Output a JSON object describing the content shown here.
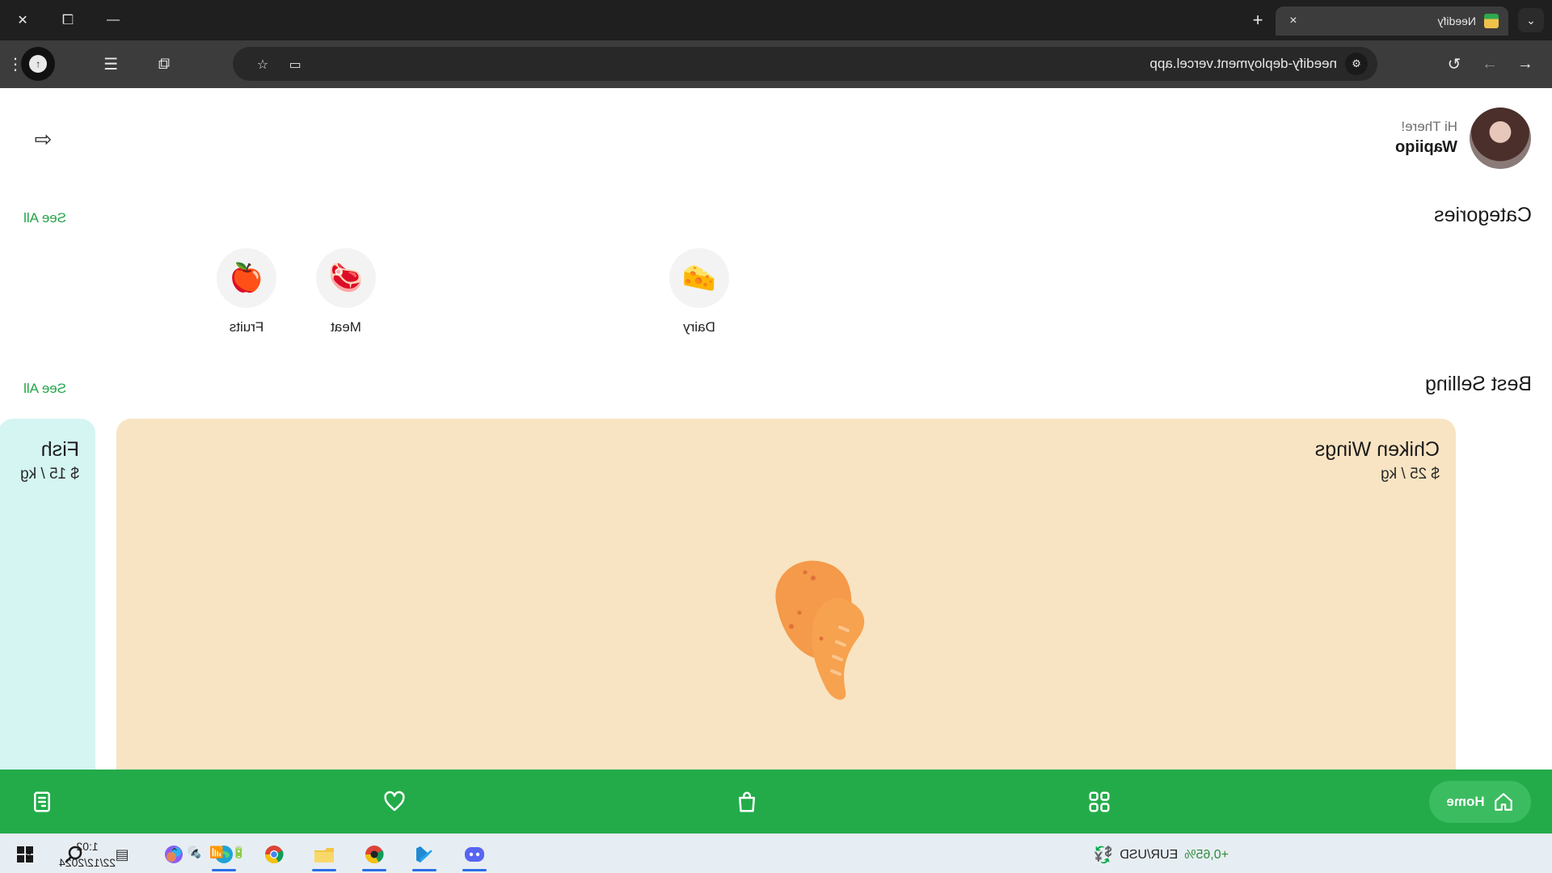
{
  "browser": {
    "tab_title": "Needify",
    "tab_close": "×",
    "new_tab": "+",
    "tab_list_icon": "⌄",
    "url": "needify-deployment.vercel.app",
    "window_minimize": "—",
    "window_restore": "❐",
    "window_close": "✕",
    "back_icon": "←",
    "forward_icon": "→",
    "reload_icon": "↻",
    "site_info_icon": "⚙",
    "cast_icon": "▭",
    "star_icon": "☆",
    "extensions_icon": "⧉",
    "sidebar_icon": "☰",
    "menu_icon": "⋮",
    "profile_letter": "↑"
  },
  "app": {
    "greeting": "Hi There!",
    "username": "Wapiiqo",
    "logout_icon": "⇦",
    "categories": {
      "title": "Categories",
      "see_all": "See All",
      "items": [
        {
          "label": "Fruits",
          "emoji": "🍎"
        },
        {
          "label": "Dairy",
          "emoji": "🧀"
        },
        {
          "label": "Meat",
          "emoji": "🥩"
        }
      ]
    },
    "best_selling": {
      "title": "Best Selling",
      "see_all": "See All",
      "products": [
        {
          "name": "Chiken Wings",
          "price": "$ 25 / kg",
          "color": "#f8e4c2"
        },
        {
          "name": "Fish",
          "price": "$ 15 / kg",
          "color": "#d4f5f2"
        }
      ]
    },
    "bottom_nav": {
      "home_label": "Home",
      "accent": "#23ab4a"
    }
  },
  "taskbar": {
    "ticker_symbol": "EUR/USD",
    "ticker_change": "+0,65%",
    "time": "1:02",
    "date": "22/12/2024",
    "notification_count": "5"
  }
}
